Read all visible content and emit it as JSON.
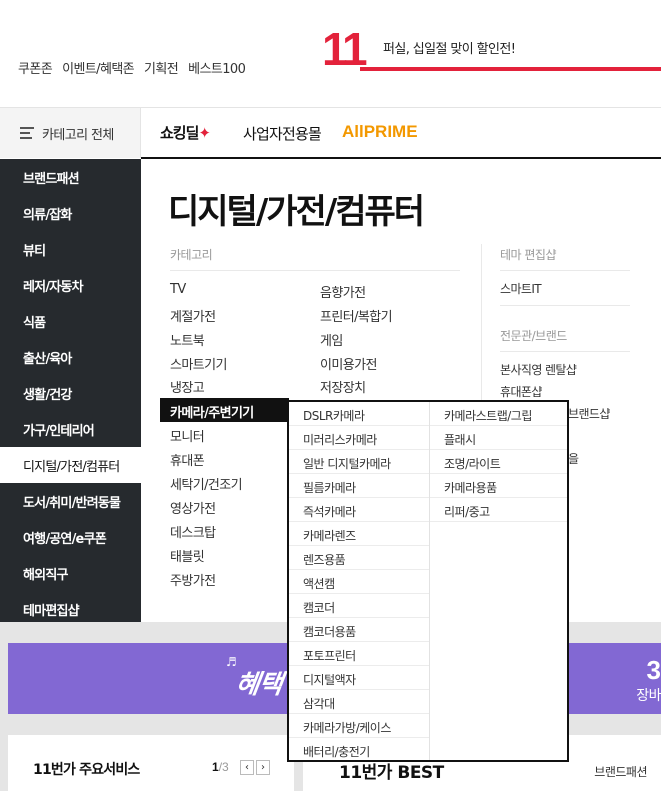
{
  "top_links": [
    "쿠폰존",
    "이벤트/혜택존",
    "기획전",
    "베스트100"
  ],
  "promo": {
    "number": "11",
    "text": "퍼실, 십일절 맞이 할인전!"
  },
  "nav": {
    "category_all": "카테고리 전체",
    "shocking_deal": "쇼킹딜",
    "office": "사업자전용몰",
    "prime": "AllPRIME"
  },
  "sidebar": [
    "브랜드패션",
    "의류/잡화",
    "뷰티",
    "레저/자동차",
    "식품",
    "출산/육아",
    "생활/건강",
    "가구/인테리어",
    "디지털/가전/컴퓨터",
    "도서/취미/반려동물",
    "여행/공연/e쿠폰",
    "해외직구",
    "테마편집샵"
  ],
  "panel": {
    "title": "디지털/가전/컴퓨터",
    "category_label": "카테고리",
    "theme_label": "테마 편집샵",
    "brand_label": "전문관/브랜드",
    "col1": [
      "TV",
      "계절가전",
      "노트북",
      "스마트기기",
      "냉장고",
      "카메라/주변기기",
      "모니터",
      "휴대폰",
      "세탁기/건조기",
      "영상가전",
      "데스크탑",
      "태블릿",
      "주방가전"
    ],
    "col2": [
      "음향가전",
      "프린터/복합기",
      "게임",
      "이미용가전",
      "저장장치"
    ],
    "theme_items": [
      "스마트IT"
    ],
    "brand_items": [
      "본사직영 렌탈샵",
      "휴대폰샵",
      "브랜드샵"
    ],
    "brand_partial": "을"
  },
  "popup": {
    "col1": [
      "DSLR카메라",
      "미러리스카메라",
      "일반 디지털카메라",
      "필름카메라",
      "즉석카메라",
      "카메라렌즈",
      "렌즈용품",
      "액션캠",
      "캠코더",
      "캠코더용품",
      "포토프린터",
      "디지털액자",
      "삼각대",
      "카메라가방/케이스",
      "배터리/충전기"
    ],
    "col2": [
      "카메라스트랩/그립",
      "플래시",
      "조명/라이트",
      "카메라용품",
      "리퍼/중고"
    ]
  },
  "banner": {
    "word": "혜택",
    "number": "3",
    "sub": "장바"
  },
  "services": {
    "title": "11번가 주요서비스",
    "page_current": "1",
    "page_total": "/3"
  },
  "best": {
    "title": "11번가 BEST",
    "tab": "브랜드패션"
  },
  "colors": {
    "accent": "#e3223b",
    "sidebar_bg": "#262a2e",
    "banner_bg": "#8268d3",
    "prime": "#f39800"
  }
}
